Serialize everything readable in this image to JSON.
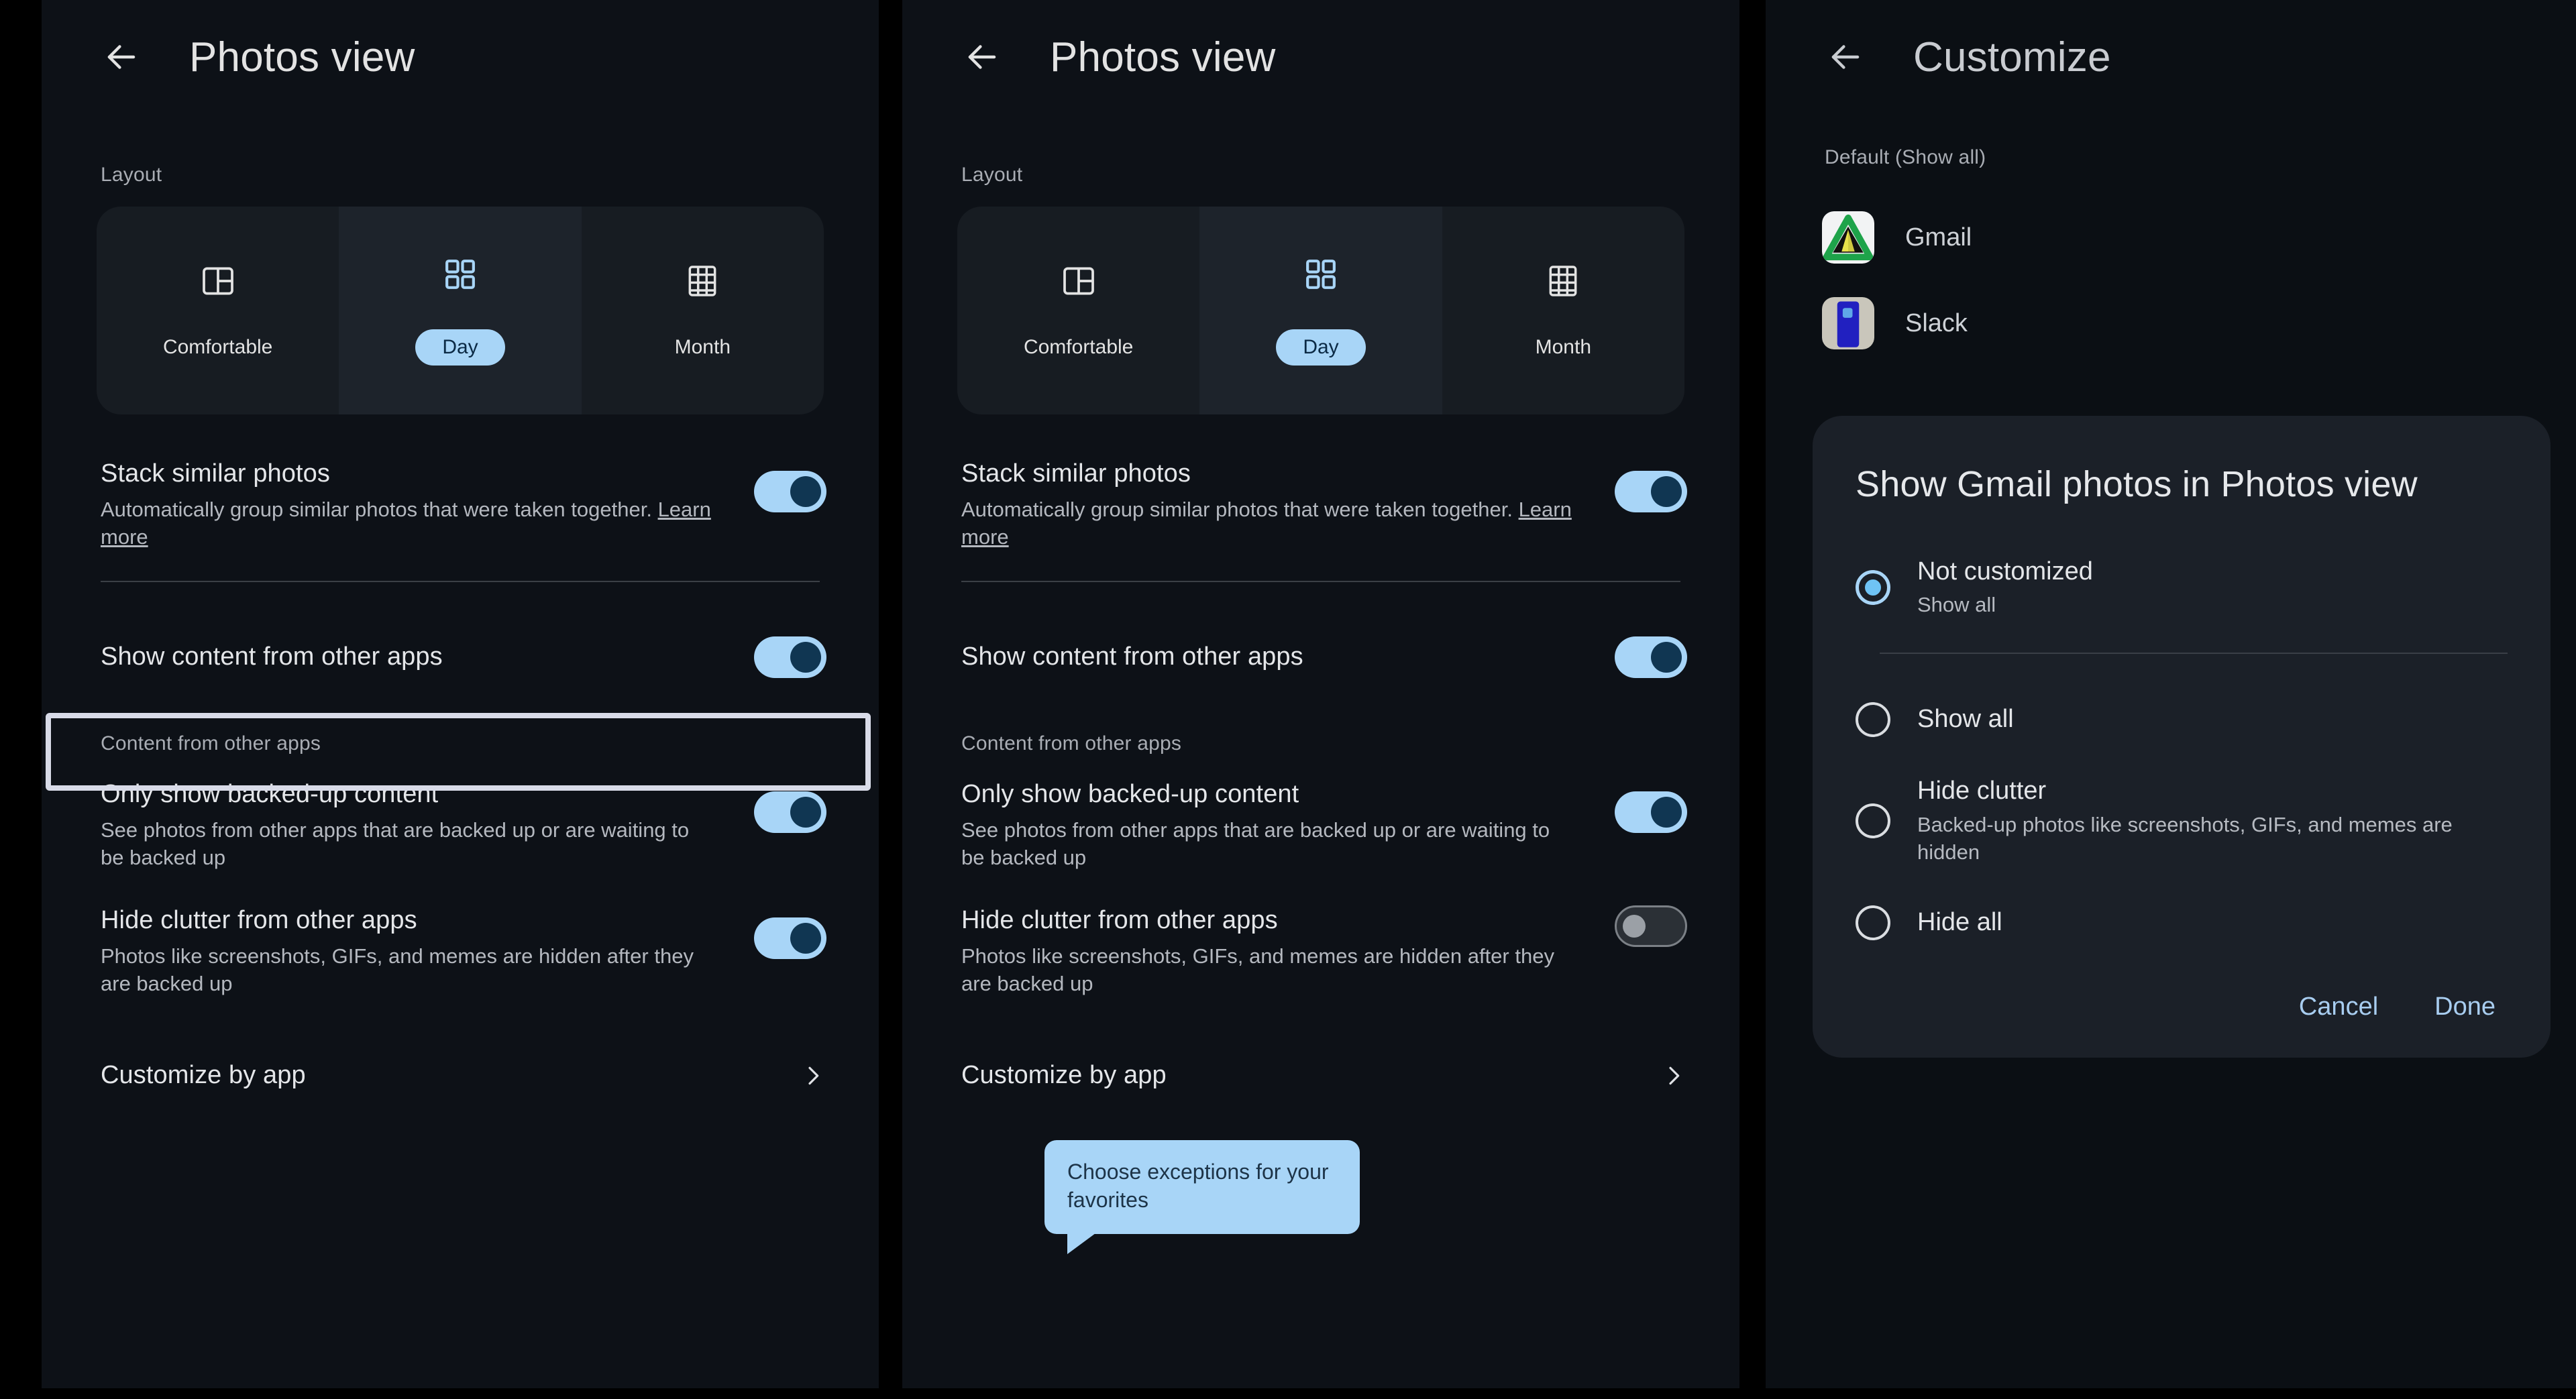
{
  "panels": [
    {
      "id": "photos-view-focused",
      "appbar": {
        "back_icon": "arrow-left-icon",
        "title": "Photos view"
      },
      "layout_section_label": "Layout",
      "layout_options": [
        {
          "label": "Comfortable",
          "icon": "comfortable-layout-icon",
          "selected": false
        },
        {
          "label": "Day",
          "icon": "day-grid-icon",
          "selected": true
        },
        {
          "label": "Month",
          "icon": "month-grid-icon",
          "selected": false
        }
      ],
      "rows": {
        "stack": {
          "title": "Stack similar photos",
          "sub": "Automatically group similar photos that were taken together. ",
          "link": "Learn more",
          "toggle": "on"
        },
        "show_content": {
          "title": "Show content from other apps",
          "toggle": "on",
          "focused": true
        },
        "content_label": "Content from other apps",
        "backed_up": {
          "title": "Only show backed-up content",
          "sub": "See photos from other apps that are backed up or are waiting to be backed up",
          "toggle": "on"
        },
        "hide_clutter": {
          "title": "Hide clutter from other apps",
          "sub": "Photos like screenshots, GIFs, and memes are hidden after they are backed up",
          "toggle": "on"
        },
        "customize": {
          "title": "Customize by app",
          "chevron": "chevron-right-icon"
        }
      }
    },
    {
      "id": "photos-view-tooltip",
      "appbar": {
        "back_icon": "arrow-left-icon",
        "title": "Photos view"
      },
      "layout_section_label": "Layout",
      "layout_options": [
        {
          "label": "Comfortable",
          "icon": "comfortable-layout-icon",
          "selected": false
        },
        {
          "label": "Day",
          "icon": "day-grid-icon",
          "selected": true
        },
        {
          "label": "Month",
          "icon": "month-grid-icon",
          "selected": false
        }
      ],
      "rows": {
        "stack": {
          "title": "Stack similar photos",
          "sub": "Automatically group similar photos that were taken together. ",
          "link": "Learn more",
          "toggle": "on"
        },
        "show_content": {
          "title": "Show content from other apps",
          "toggle": "on",
          "focused": false
        },
        "content_label": "Content from other apps",
        "backed_up": {
          "title": "Only show backed-up content",
          "sub": "See photos from other apps that are backed up or are waiting to be backed up",
          "toggle": "on"
        },
        "hide_clutter": {
          "title": "Hide clutter from other apps",
          "sub": "Photos like screenshots, GIFs, and memes are hidden after they are backed up",
          "sub_visible_tail": "and memes are hidden",
          "toggle": "off"
        },
        "customize": {
          "title": "Customize by app",
          "chevron": "chevron-right-icon"
        }
      },
      "tooltip": {
        "text": "Choose exceptions for your favorites"
      }
    }
  ],
  "customize_panel": {
    "appbar": {
      "back_icon": "arrow-left-icon",
      "title": "Customize"
    },
    "section_label": "Default (Show all)",
    "apps": [
      {
        "name": "Gmail",
        "icon": "gmail-app-icon"
      },
      {
        "name": "Slack",
        "icon": "slack-app-icon"
      }
    ],
    "dialog": {
      "title": "Show Gmail photos in Photos view",
      "options": [
        {
          "title": "Not customized",
          "sub": "Show all",
          "selected": true
        },
        {
          "title": "Show all",
          "sub": "",
          "selected": false
        },
        {
          "title": "Hide clutter",
          "sub": "Backed-up photos like screenshots, GIFs, and memes are hidden",
          "selected": false
        },
        {
          "title": "Hide all",
          "sub": "",
          "selected": false
        }
      ],
      "cancel_label": "Cancel",
      "done_label": "Done"
    }
  },
  "colors": {
    "accent_blue": "#a8d5f7",
    "toggle_on_track": "#a8d5f7",
    "toggle_on_thumb": "#103652",
    "toggle_off_track": "#2b3036",
    "panel_bg": "#0d1117",
    "dialog_bg": "#1b2028",
    "focus_ring": "#d8dbe8",
    "dialog_action": "#a8cdf0"
  }
}
